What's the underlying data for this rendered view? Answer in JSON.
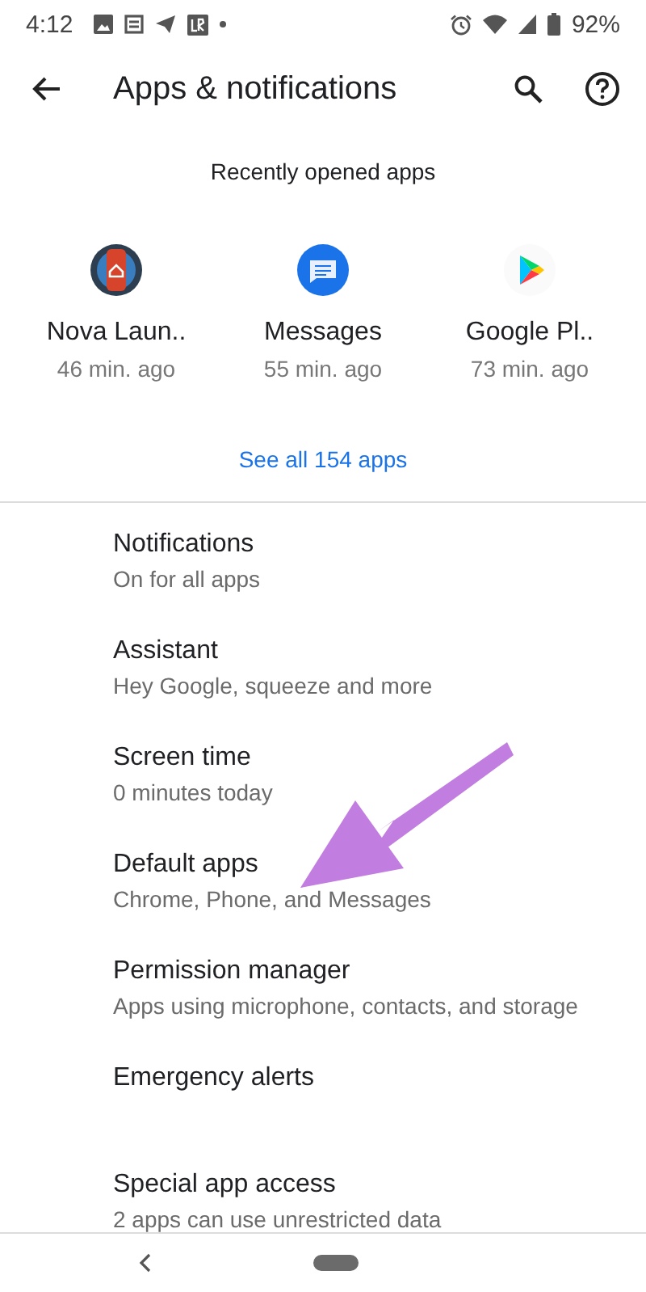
{
  "status_bar": {
    "time": "4:12",
    "battery_text": "92%"
  },
  "toolbar": {
    "title": "Apps & notifications"
  },
  "recent_apps": {
    "heading": "Recently opened apps",
    "apps": [
      {
        "name": "Nova Laun..",
        "time": "46 min. ago",
        "kind": "nova"
      },
      {
        "name": "Messages",
        "time": "55 min. ago",
        "kind": "messages"
      },
      {
        "name": "Google Pl..",
        "time": "73 min. ago",
        "kind": "play"
      }
    ],
    "see_all": "See all 154 apps"
  },
  "settings": [
    {
      "title": "Notifications",
      "subtitle": "On for all apps"
    },
    {
      "title": "Assistant",
      "subtitle": "Hey Google, squeeze and more"
    },
    {
      "title": "Screen time",
      "subtitle": "0 minutes today"
    },
    {
      "title": "Default apps",
      "subtitle": "Chrome, Phone, and Messages"
    },
    {
      "title": "Permission manager",
      "subtitle": "Apps using microphone, contacts, and storage"
    },
    {
      "title": "Emergency alerts"
    },
    {
      "title": "Special app access",
      "subtitle": "2 apps can use unrestricted data"
    }
  ]
}
